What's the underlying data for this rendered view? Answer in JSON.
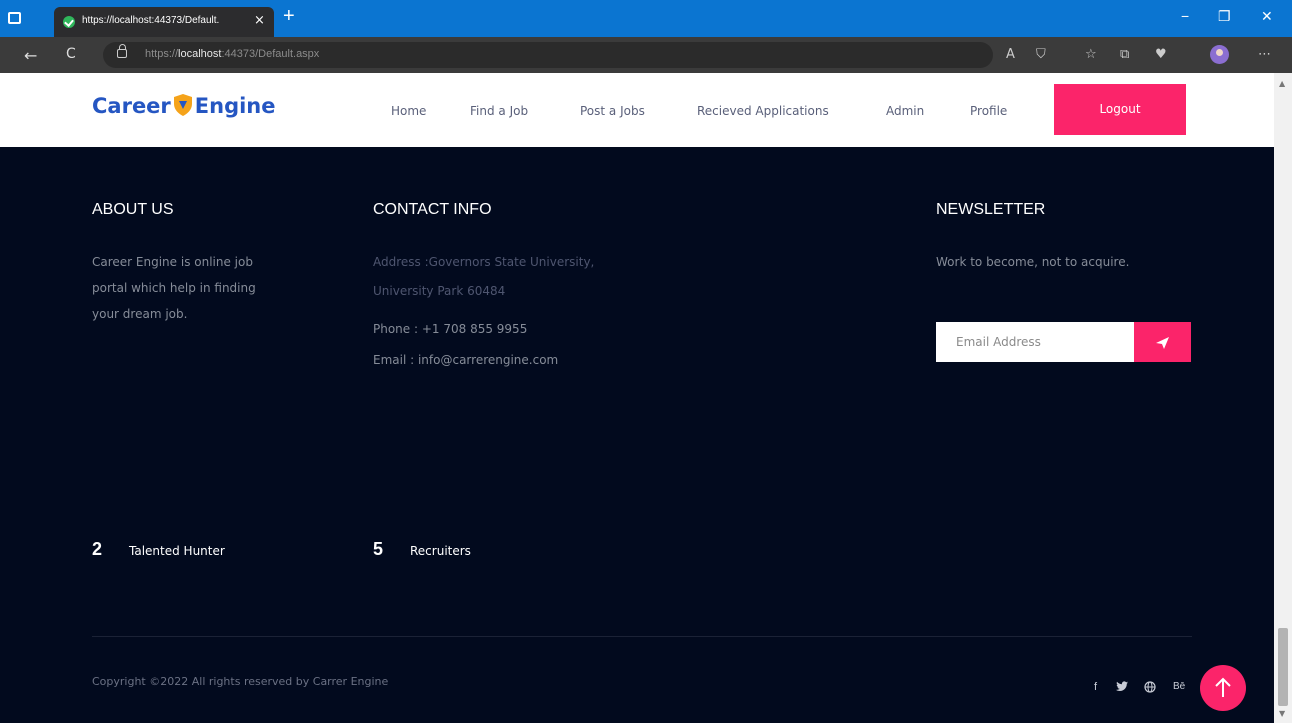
{
  "browser": {
    "tab_title": "https://localhost:44373/Default.",
    "tab_close": "×",
    "new_tab": "+",
    "url_prefix": "https://",
    "url_host": "localhost",
    "url_rest": ":44373/Default.aspx",
    "back": "←",
    "refresh": "C",
    "controls": {
      "minimize": "−",
      "restore": "❐",
      "close": "✕"
    },
    "toolbar_icons": [
      "read-aloud-icon",
      "tracking-icon",
      "favorites-icon",
      "collections-icon",
      "health-icon",
      "profile-avatar",
      "more-icon"
    ]
  },
  "site": {
    "logo_left": "Career",
    "logo_right": "Engine",
    "nav": [
      "Home",
      "Find a Job",
      "Post a Jobs",
      "Recieved Applications",
      "Admin",
      "Profile"
    ],
    "logout_label": "Logout"
  },
  "footer": {
    "about": {
      "heading": "ABOUT US",
      "lines": [
        "Career Engine is online job",
        "portal which help in finding",
        "your dream job."
      ]
    },
    "contact": {
      "heading": "CONTACT INFO",
      "address_lines": [
        "Address :Governors State University,",
        "University Park 60484"
      ],
      "phone": "Phone : +1 708 855 9955",
      "email": "Email : info@carrerengine.com"
    },
    "newsletter": {
      "heading": "NEWSLETTER",
      "tagline": "Work to become, not to acquire.",
      "email_placeholder": "Email Address"
    },
    "stats": [
      {
        "number": "2",
        "label": "Talented Hunter"
      },
      {
        "number": "5",
        "label": "Recruiters"
      }
    ],
    "copyright": "Copyright ©2022 All rights reserved by Carrer Engine",
    "social": [
      "f",
      "Bē"
    ],
    "colors": {
      "accent": "#fb246a",
      "footer_bg": "#020a1e",
      "brand_blue": "#2556c2",
      "shield_orange": "#f5a31a"
    }
  }
}
